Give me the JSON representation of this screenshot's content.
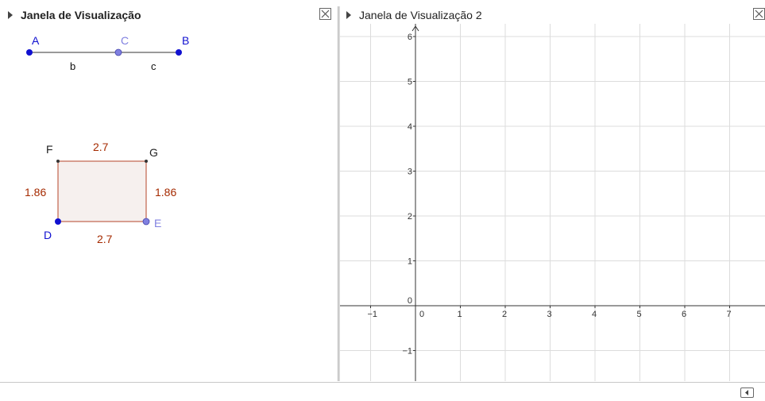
{
  "panels": {
    "left": {
      "title": "Janela de Visualização"
    },
    "right": {
      "title": "Janela de Visualização 2"
    }
  },
  "construction": {
    "points": {
      "A": "A",
      "B": "B",
      "C": "C",
      "D": "D",
      "E": "E",
      "F": "F",
      "G": "G"
    },
    "segments": {
      "b": "b",
      "c": "c"
    },
    "rectangle_labels": {
      "top": "2.7",
      "bottom": "2.7",
      "left": "1.86",
      "right": "1.86"
    }
  },
  "graph": {
    "x_ticks": [
      "−1",
      "0",
      "1",
      "2",
      "3",
      "4",
      "5",
      "6",
      "7"
    ],
    "y_ticks": [
      "6",
      "5",
      "4",
      "3",
      "2",
      "1",
      "0",
      "−1"
    ]
  },
  "colors": {
    "free_point": "#1010d0",
    "dependent_point": "#8080e0",
    "measure": "#a52a00",
    "polygon_fill": "#f6f0ee"
  },
  "icons": {
    "close": "close-icon",
    "keyboard": "keyboard-icon",
    "collapse": "triangle-right-icon"
  }
}
